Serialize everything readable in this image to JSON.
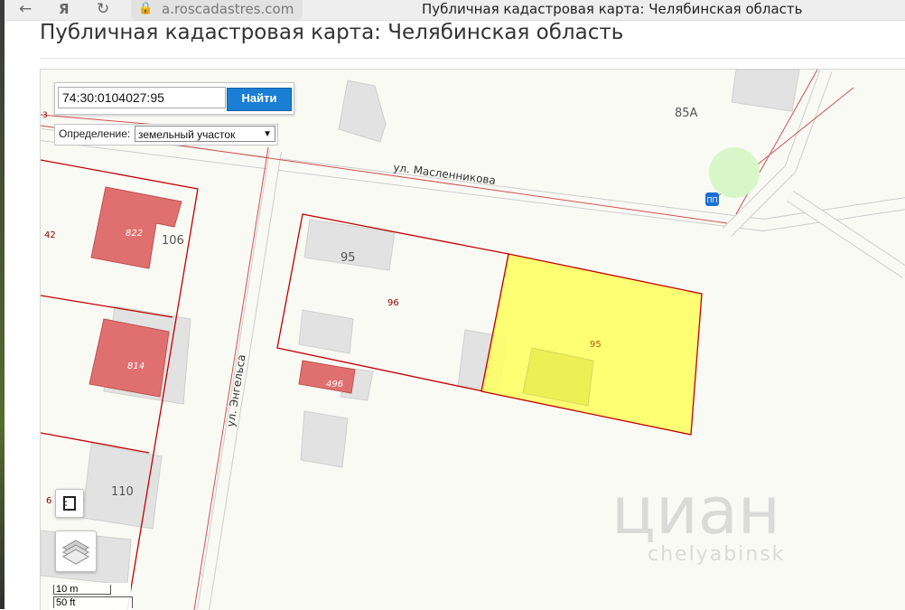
{
  "browser": {
    "url": "a.roscadastres.com",
    "window_title": "Публичная кадастровая карта: Челябинская область",
    "back_icon": "←",
    "yandex_icon": "Я",
    "reload_icon": "↻"
  },
  "page": {
    "title": "Публичная кадастровая карта: Челябинская область"
  },
  "search": {
    "value": "74:30:0104027:95",
    "button_label": "Найти"
  },
  "definition": {
    "label": "Определение:",
    "selected": "земельный участок"
  },
  "map": {
    "street_maslennikova": "ул. Масленникова",
    "street_engelsa": "ул. Энгельса",
    "house_85a": "85А",
    "house_95": "95",
    "house_106": "106",
    "house_110": "110",
    "parcel_822": "822",
    "parcel_814": "814",
    "parcel_496": "496",
    "parcel_96": "96",
    "parcel_95": "95",
    "parcel_42": "42",
    "parcel_6": "6",
    "parcel_edge_3": "3",
    "bus_stop": "ПП",
    "selected_color": "#ffff66",
    "boundary_color": "#c00000",
    "building_red": "#e07070"
  },
  "scale": {
    "metric": "10 m",
    "imperial": "50 ft"
  },
  "watermark": {
    "brand": "циан",
    "domain": "chelyabinsk"
  }
}
